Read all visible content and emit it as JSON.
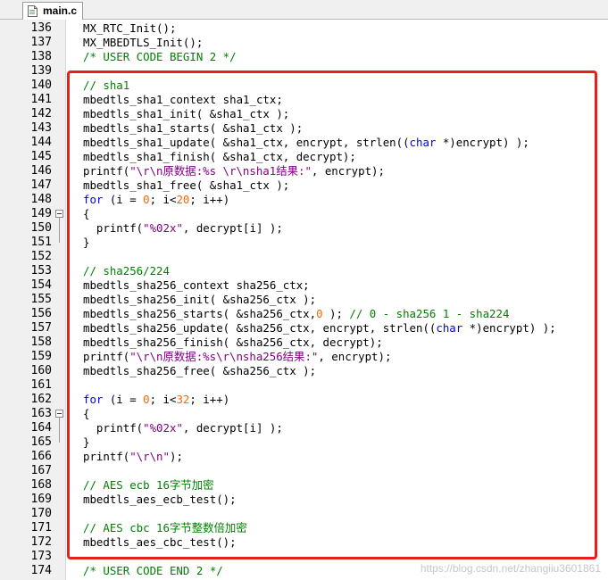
{
  "tab": {
    "label": "main.c"
  },
  "colors": {
    "comment": "#008000",
    "keyword": "#0000ff",
    "string": "#800080",
    "number": "#ff6600",
    "highlight_box": "#e8201d"
  },
  "lines": [
    {
      "n": "136",
      "seg": [
        {
          "t": "MX_RTC_Init();"
        }
      ]
    },
    {
      "n": "137",
      "seg": [
        {
          "t": "MX_MBEDTLS_Init();"
        }
      ]
    },
    {
      "n": "138",
      "seg": [
        {
          "t": "/* USER CODE BEGIN 2 */",
          "c": "cmt"
        }
      ]
    },
    {
      "n": "139",
      "seg": []
    },
    {
      "n": "140",
      "seg": [
        {
          "t": "// sha1",
          "c": "cmt"
        }
      ]
    },
    {
      "n": "141",
      "seg": [
        {
          "t": "mbedtls_sha1_context sha1_ctx;"
        }
      ]
    },
    {
      "n": "142",
      "seg": [
        {
          "t": "mbedtls_sha1_init( &sha1_ctx );"
        }
      ]
    },
    {
      "n": "143",
      "seg": [
        {
          "t": "mbedtls_sha1_starts( &sha1_ctx );"
        }
      ]
    },
    {
      "n": "144",
      "seg": [
        {
          "t": "mbedtls_sha1_update( &sha1_ctx, encrypt, strlen(("
        },
        {
          "t": "char",
          "c": "kw"
        },
        {
          "t": " *)encrypt) );"
        }
      ]
    },
    {
      "n": "145",
      "seg": [
        {
          "t": "mbedtls_sha1_finish( &sha1_ctx, decrypt);"
        }
      ]
    },
    {
      "n": "146",
      "seg": [
        {
          "t": "printf("
        },
        {
          "t": "\"\\r\\n原数据:%s \\r\\nsha1结果:\"",
          "c": "str"
        },
        {
          "t": ", encrypt);"
        }
      ]
    },
    {
      "n": "147",
      "seg": [
        {
          "t": "mbedtls_sha1_free( &sha1_ctx );"
        }
      ]
    },
    {
      "n": "148",
      "seg": [
        {
          "t": "for",
          "c": "kw"
        },
        {
          "t": " (i = "
        },
        {
          "t": "0",
          "c": "num"
        },
        {
          "t": "; i<"
        },
        {
          "t": "20",
          "c": "num"
        },
        {
          "t": "; i++)"
        }
      ]
    },
    {
      "n": "149",
      "fold": true,
      "seg": [
        {
          "t": "{"
        }
      ]
    },
    {
      "n": "150",
      "seg": [
        {
          "t": "  printf("
        },
        {
          "t": "\"%02x\"",
          "c": "str"
        },
        {
          "t": ", decrypt[i] );"
        }
      ]
    },
    {
      "n": "151",
      "seg": [
        {
          "t": "}"
        }
      ]
    },
    {
      "n": "152",
      "seg": []
    },
    {
      "n": "153",
      "seg": [
        {
          "t": "// sha256/224",
          "c": "cmt"
        }
      ]
    },
    {
      "n": "154",
      "seg": [
        {
          "t": "mbedtls_sha256_context sha256_ctx;"
        }
      ]
    },
    {
      "n": "155",
      "seg": [
        {
          "t": "mbedtls_sha256_init( &sha256_ctx );"
        }
      ]
    },
    {
      "n": "156",
      "seg": [
        {
          "t": "mbedtls_sha256_starts( &sha256_ctx,"
        },
        {
          "t": "0",
          "c": "num"
        },
        {
          "t": " ); "
        },
        {
          "t": "// 0 - sha256 1 - sha224",
          "c": "cmt"
        }
      ]
    },
    {
      "n": "157",
      "seg": [
        {
          "t": "mbedtls_sha256_update( &sha256_ctx, encrypt, strlen(("
        },
        {
          "t": "char",
          "c": "kw"
        },
        {
          "t": " *)encrypt) );"
        }
      ]
    },
    {
      "n": "158",
      "seg": [
        {
          "t": "mbedtls_sha256_finish( &sha256_ctx, decrypt);"
        }
      ]
    },
    {
      "n": "159",
      "seg": [
        {
          "t": "printf("
        },
        {
          "t": "\"\\r\\n原数据:%s\\r\\nsha256结果:\"",
          "c": "str"
        },
        {
          "t": ", encrypt);"
        }
      ]
    },
    {
      "n": "160",
      "seg": [
        {
          "t": "mbedtls_sha256_free( &sha256_ctx );"
        }
      ]
    },
    {
      "n": "161",
      "seg": []
    },
    {
      "n": "162",
      "seg": [
        {
          "t": "for",
          "c": "kw"
        },
        {
          "t": " (i = "
        },
        {
          "t": "0",
          "c": "num"
        },
        {
          "t": "; i<"
        },
        {
          "t": "32",
          "c": "num"
        },
        {
          "t": "; i++)"
        }
      ]
    },
    {
      "n": "163",
      "fold": true,
      "seg": [
        {
          "t": "{"
        }
      ]
    },
    {
      "n": "164",
      "seg": [
        {
          "t": "  printf("
        },
        {
          "t": "\"%02x\"",
          "c": "str"
        },
        {
          "t": ", decrypt[i] );"
        }
      ]
    },
    {
      "n": "165",
      "seg": [
        {
          "t": "}"
        }
      ]
    },
    {
      "n": "166",
      "seg": [
        {
          "t": "printf("
        },
        {
          "t": "\"\\r\\n\"",
          "c": "str"
        },
        {
          "t": ");"
        }
      ]
    },
    {
      "n": "167",
      "seg": []
    },
    {
      "n": "168",
      "seg": [
        {
          "t": "// AES ecb 16字节加密",
          "c": "cmt"
        }
      ]
    },
    {
      "n": "169",
      "seg": [
        {
          "t": "mbedtls_aes_ecb_test();"
        }
      ]
    },
    {
      "n": "170",
      "seg": []
    },
    {
      "n": "171",
      "seg": [
        {
          "t": "// AES cbc 16字节整数倍加密",
          "c": "cmt"
        }
      ]
    },
    {
      "n": "172",
      "seg": [
        {
          "t": "mbedtls_aes_cbc_test();"
        }
      ]
    },
    {
      "n": "173",
      "seg": []
    },
    {
      "n": "174",
      "seg": [
        {
          "t": "/* USER CODE END 2 */",
          "c": "cmt"
        }
      ]
    }
  ],
  "watermark": "https://blog.csdn.net/zhangiiu3601861"
}
